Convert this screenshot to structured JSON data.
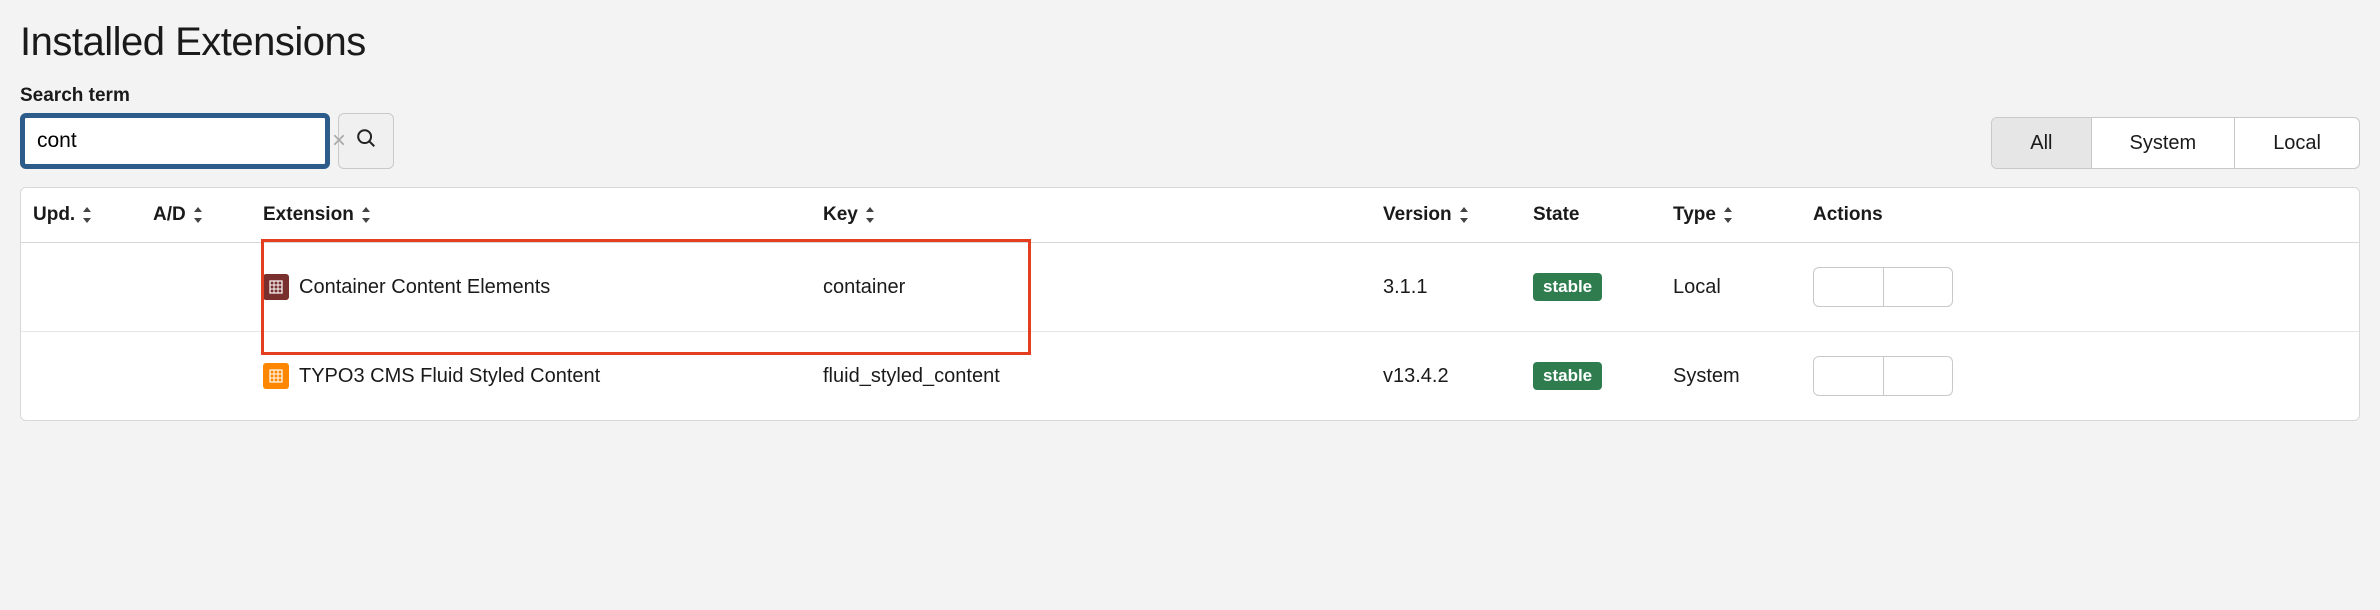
{
  "page": {
    "title": "Installed Extensions"
  },
  "search": {
    "label": "Search term",
    "value": "cont"
  },
  "filters": {
    "items": [
      {
        "label": "All",
        "active": true
      },
      {
        "label": "System",
        "active": false
      },
      {
        "label": "Local",
        "active": false
      }
    ]
  },
  "table": {
    "headers": {
      "upd": "Upd.",
      "ad": "A/D",
      "extension": "Extension",
      "key": "Key",
      "version": "Version",
      "state": "State",
      "type": "Type",
      "actions": "Actions"
    },
    "rows": [
      {
        "icon_color": "#7a2f2f",
        "name": "Container Content Elements",
        "key": "container",
        "version": "3.1.1",
        "state": "stable",
        "type": "Local",
        "highlighted": true
      },
      {
        "icon_color": "#ff8700",
        "name": "TYPO3 CMS Fluid Styled Content",
        "key": "fluid_styled_content",
        "version": "v13.4.2",
        "state": "stable",
        "type": "System",
        "highlighted": false
      }
    ]
  }
}
